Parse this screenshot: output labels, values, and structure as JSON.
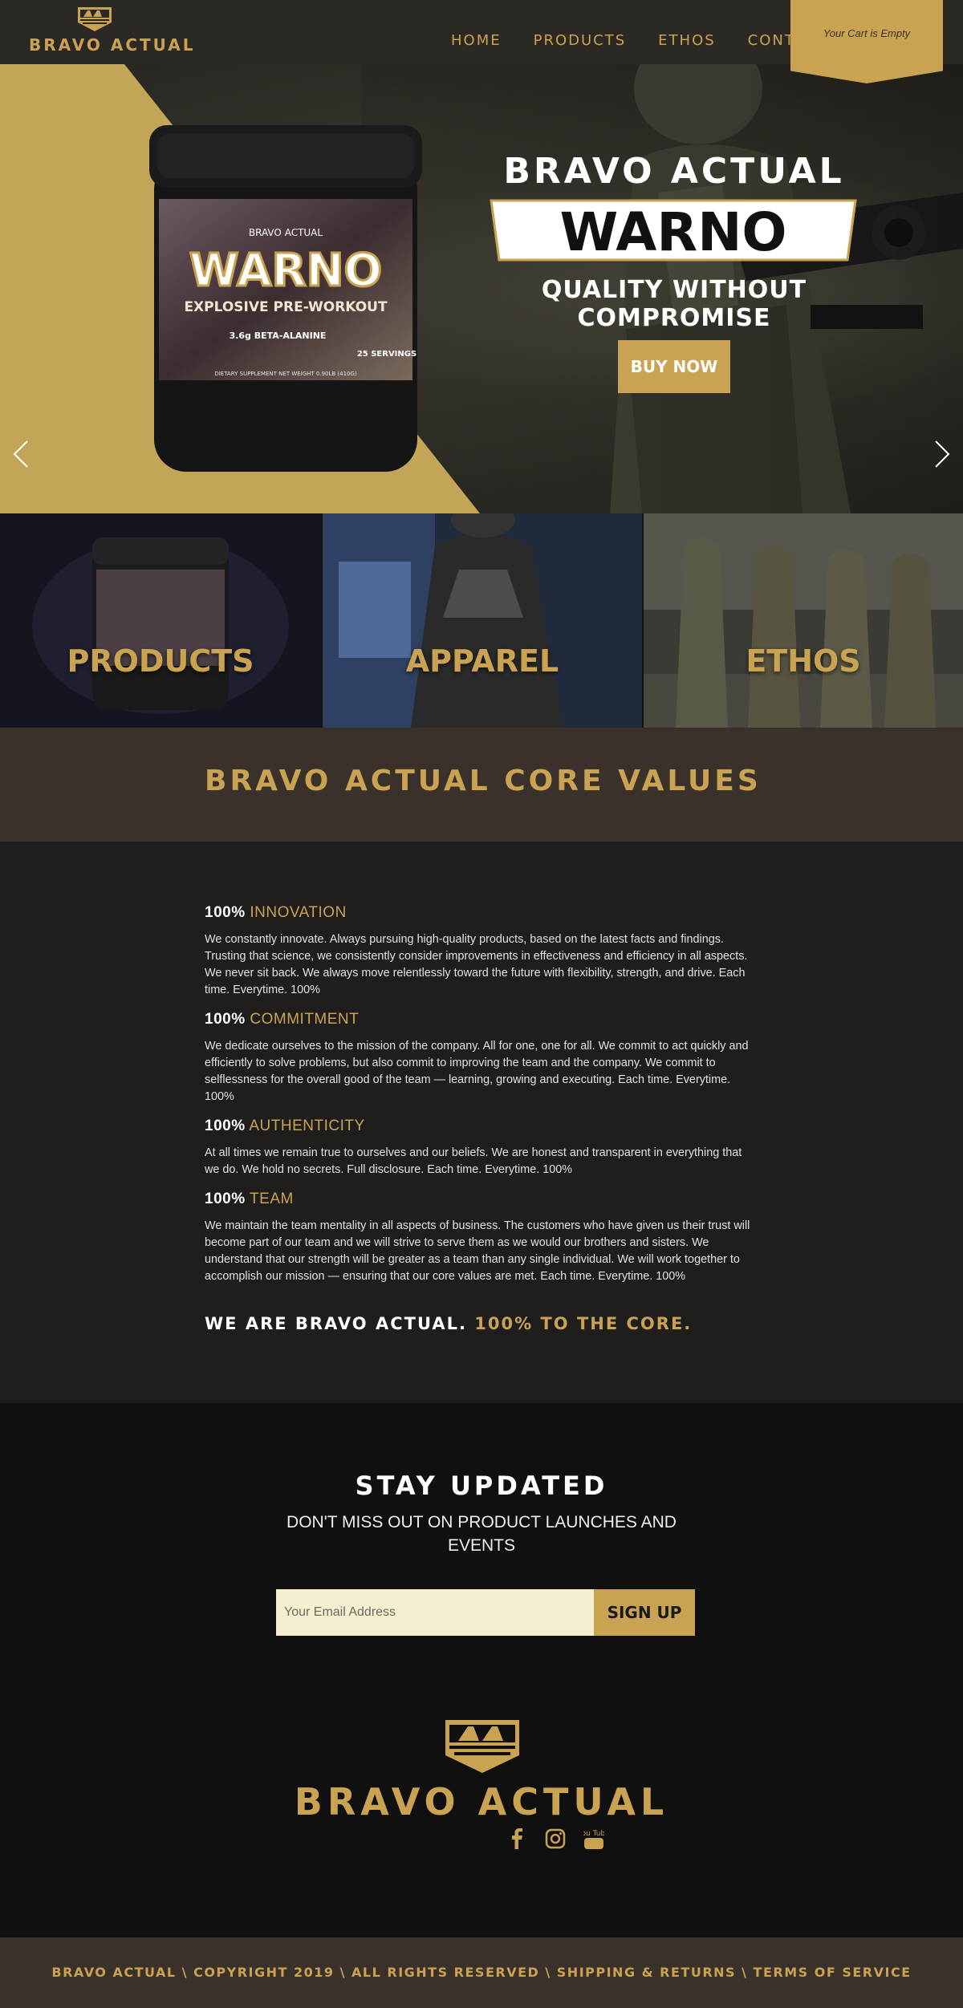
{
  "header": {
    "logo_text": "BRAVO ACTUAL",
    "nav": [
      "HOME",
      "PRODUCTS",
      "ETHOS",
      "CONTACT"
    ],
    "cart_text": "Your Cart is Empty"
  },
  "hero": {
    "brand": "BRAVO ACTUAL",
    "product": "WARNO",
    "tagline": "QUALITY WITHOUT COMPROMISE",
    "buy_label": "BUY NOW",
    "jar": {
      "brand": "BRAVO ACTUAL",
      "name": "WARNO",
      "subtitle": "EXPLOSIVE PRE-WORKOUT",
      "facts": [
        "3.6g BETA-ALANINE",
        "25 SERVINGS"
      ],
      "net_weight": "DIETARY SUPPLEMENT NET WEIGHT 0.90LB (410G)"
    }
  },
  "tiles": [
    "PRODUCTS",
    "APPAREL",
    "ETHOS"
  ],
  "core_values": {
    "title": "BRAVO ACTUAL CORE VALUES",
    "items": [
      {
        "percent": "100%",
        "name": "INNOVATION",
        "text": "We constantly innovate. Always pursuing high-quality products, based on the latest facts and findings. Trusting that science, we consistently consider improvements in effectiveness and efficiency in all aspects. We never sit back. We always move relentlessly toward the future with flexibility, strength, and drive. Each time. Everytime. 100%"
      },
      {
        "percent": "100%",
        "name": "COMMITMENT",
        "text": "We dedicate ourselves to the mission of the company. All for one, one for all. We commit to act quickly and efficiently to solve problems, but also commit to improving the team and the company. We commit to selflessness for the overall good of the team — learning, growing and executing. Each time. Everytime. 100%"
      },
      {
        "percent": "100%",
        "name": "AUTHENTICITY",
        "text": "At all times we remain true to ourselves and our beliefs. We are honest and transparent in everything that we do. We hold no secrets. Full disclosure. Each time. Everytime. 100%"
      },
      {
        "percent": "100%",
        "name": "TEAM",
        "text": "We maintain the team mentality in all aspects of business. The customers who have given us their trust will become part of our team and we will strive to serve them as we would our brothers and sisters. We understand that our strength will be greater as a team than any single individual. We will work together to accomplish our mission — ensuring that our core values are met. Each time. Everytime. 100%"
      }
    ],
    "motto_white": "WE ARE BRAVO ACTUAL.",
    "motto_gold": "100% TO THE CORE."
  },
  "newsletter": {
    "title": "STAY UPDATED",
    "subtitle": "DON'T MISS OUT ON PRODUCT LAUNCHES AND EVENTS",
    "email_placeholder": "Your Email Address",
    "signup_label": "SIGN UP"
  },
  "footer": {
    "brand": "BRAVO ACTUAL",
    "socials": [
      "facebook-icon",
      "instagram-icon",
      "youtube-icon"
    ],
    "youtube_text": "You Tube",
    "bottom_items": [
      "BRAVO ACTUAL",
      "COPYRIGHT 2019",
      "ALL RIGHTS RESERVED",
      "SHIPPING & RETURNS",
      "TERMS OF SERVICE"
    ],
    "separator": " \\ "
  },
  "colors": {
    "gold": "#c9a352",
    "dark_brown": "#3a312a",
    "header_bg": "#2c2824",
    "body_dark": "#1f1e1d",
    "footer_dark": "#101010",
    "email_bg": "#f6efcf"
  }
}
